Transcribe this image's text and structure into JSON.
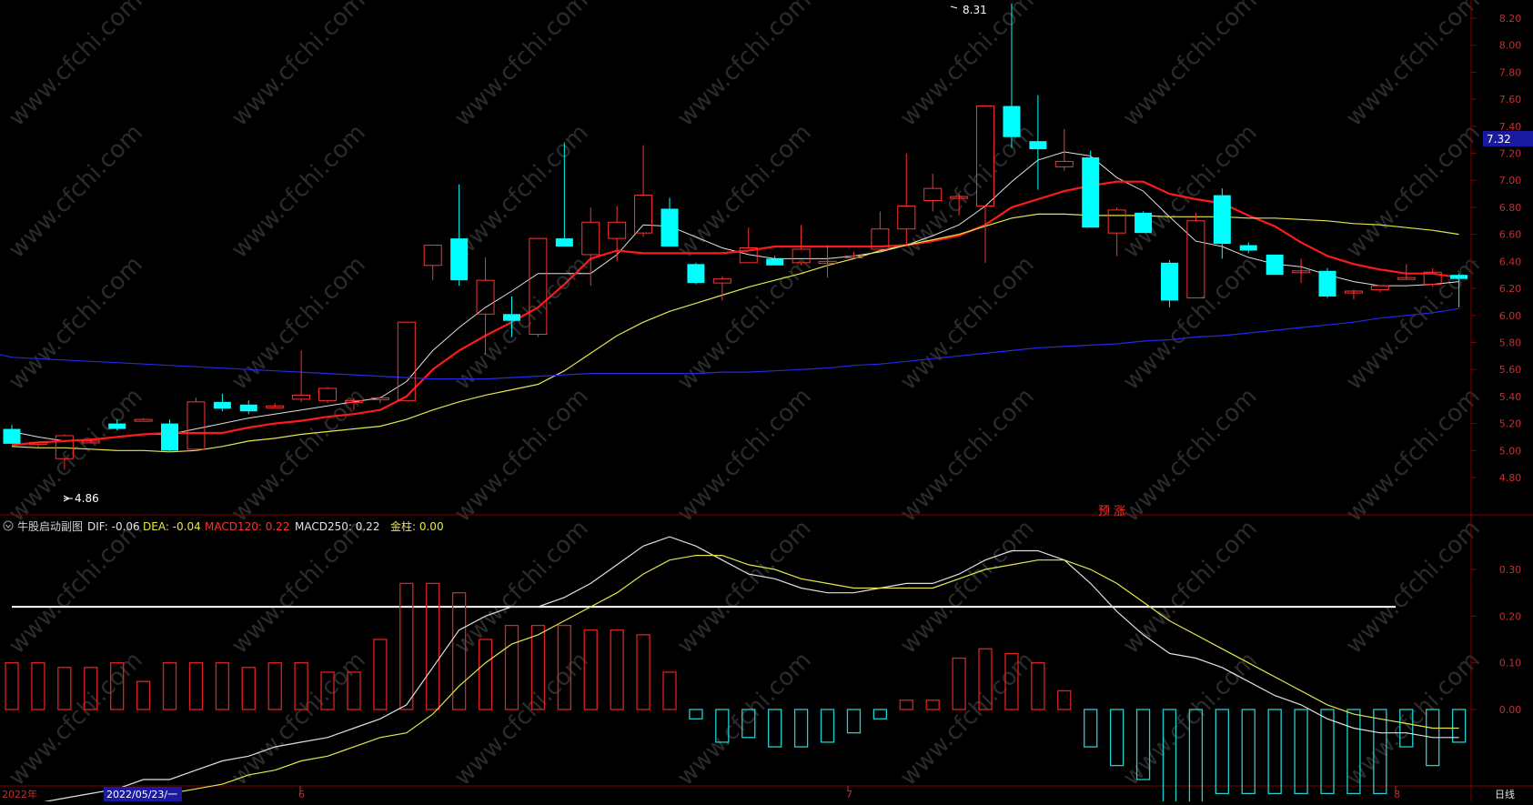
{
  "colors": {
    "background": "#000000",
    "frame": "#800000",
    "axis_text": "#c03030",
    "up_candle": "#ff3232",
    "down_candle": "#00ffff",
    "ma5": "#e0e0e0",
    "ma10": "#ff1a1a",
    "ma20": "#e6e64c",
    "ma60": "#2828e6",
    "dif": "#e0e0e0",
    "dea": "#e6e64c",
    "hist_pos": "#e02020",
    "hist_neg": "#20d0d0",
    "ref_line": "#ffffff",
    "watermark": "#2b2b2b"
  },
  "main_panel": {
    "price_axis_ticks": [
      "8.20",
      "8.00",
      "7.80",
      "7.60",
      "7.40",
      "7.20",
      "7.00",
      "6.80",
      "6.60",
      "6.40",
      "6.20",
      "6.00",
      "5.80",
      "5.60",
      "5.40",
      "5.20",
      "5.00",
      "4.80"
    ],
    "current_price_tag": "7.32",
    "high_annotation": "8.31",
    "low_annotation": "4.86",
    "signal_text": "预  涨",
    "watermark_text": "www.cfchi.com"
  },
  "indicator_panel": {
    "name": "牛股启动副图",
    "dif_label": "DIF: -0.06",
    "dea_label": "DEA: -0.04",
    "macd120_label": "MACD120: 0.22",
    "macd250_label": "MACD250: 0.22",
    "jinzhu_label": "金柱: 0.00",
    "axis_ticks": [
      "0.30",
      "0.20",
      "0.10",
      "0.00"
    ],
    "collapse_icon": "chevron-down-circle-icon"
  },
  "bottom_bar": {
    "year_label": "2022年",
    "cursor_date": "2022/05/23/一",
    "month_6": "6",
    "month_7": "7",
    "month_8": "8",
    "period_label": "日线"
  },
  "chart_data": [
    {
      "type": "candlestick",
      "title": "",
      "ylim": [
        4.72,
        8.31
      ],
      "fields": [
        "open",
        "high",
        "low",
        "close"
      ],
      "candles": [
        [
          5.16,
          5.19,
          5.05,
          5.05
        ],
        [
          5.05,
          5.06,
          5.02,
          5.06
        ],
        [
          4.94,
          5.12,
          4.86,
          5.11
        ],
        [
          5.07,
          5.09,
          5.06,
          5.07
        ],
        [
          5.2,
          5.23,
          5.15,
          5.16
        ],
        [
          5.22,
          5.24,
          5.22,
          5.23
        ],
        [
          5.2,
          5.23,
          4.99,
          5.0
        ],
        [
          5.01,
          5.39,
          5.0,
          5.36
        ],
        [
          5.36,
          5.42,
          5.29,
          5.31
        ],
        [
          5.34,
          5.37,
          5.27,
          5.29
        ],
        [
          5.33,
          5.35,
          5.32,
          5.33
        ],
        [
          5.38,
          5.74,
          5.36,
          5.41
        ],
        [
          5.37,
          5.47,
          5.35,
          5.46
        ],
        [
          5.37,
          5.39,
          5.3,
          5.37
        ],
        [
          5.38,
          5.4,
          5.35,
          5.39
        ],
        [
          5.37,
          5.95,
          5.37,
          5.95
        ],
        [
          6.37,
          6.52,
          6.26,
          6.52
        ],
        [
          6.57,
          6.97,
          6.22,
          6.26
        ],
        [
          6.01,
          6.43,
          5.71,
          6.26
        ],
        [
          6.01,
          6.14,
          5.84,
          5.96
        ],
        [
          5.86,
          6.57,
          5.84,
          6.57
        ],
        [
          6.57,
          7.28,
          6.54,
          6.51
        ],
        [
          6.45,
          6.8,
          6.22,
          6.69
        ],
        [
          6.57,
          6.81,
          6.4,
          6.69
        ],
        [
          6.61,
          7.26,
          6.58,
          6.89
        ],
        [
          6.79,
          6.87,
          6.51,
          6.51
        ],
        [
          6.38,
          6.39,
          6.23,
          6.24
        ],
        [
          6.24,
          6.29,
          6.11,
          6.27
        ],
        [
          6.39,
          6.65,
          6.39,
          6.5
        ],
        [
          6.42,
          6.44,
          6.37,
          6.37
        ],
        [
          6.39,
          6.67,
          6.37,
          6.49
        ],
        [
          6.4,
          6.52,
          6.28,
          6.4
        ],
        [
          6.44,
          6.47,
          6.42,
          6.44
        ],
        [
          6.49,
          6.77,
          6.48,
          6.64
        ],
        [
          6.64,
          7.2,
          6.52,
          6.81
        ],
        [
          6.85,
          7.05,
          6.77,
          6.94
        ],
        [
          6.88,
          6.9,
          6.74,
          6.88
        ],
        [
          6.81,
          7.55,
          6.39,
          7.55
        ],
        [
          7.55,
          8.31,
          7.24,
          7.32
        ],
        [
          7.29,
          7.63,
          6.93,
          7.23
        ],
        [
          7.1,
          7.38,
          7.07,
          7.14
        ],
        [
          7.17,
          7.22,
          6.65,
          6.65
        ],
        [
          6.61,
          6.8,
          6.44,
          6.78
        ],
        [
          6.76,
          6.77,
          6.61,
          6.61
        ],
        [
          6.39,
          6.41,
          6.06,
          6.11
        ],
        [
          6.13,
          6.76,
          6.13,
          6.7
        ],
        [
          6.89,
          6.94,
          6.42,
          6.53
        ],
        [
          6.52,
          6.54,
          6.46,
          6.48
        ],
        [
          6.45,
          6.45,
          6.3,
          6.3
        ],
        [
          6.33,
          6.42,
          6.24,
          6.33
        ],
        [
          6.33,
          6.35,
          6.13,
          6.14
        ],
        [
          6.18,
          6.19,
          6.12,
          6.18
        ],
        [
          6.19,
          6.22,
          6.17,
          6.22
        ],
        [
          6.28,
          6.38,
          6.27,
          6.28
        ],
        [
          6.23,
          6.35,
          6.21,
          6.32
        ],
        [
          6.3,
          6.31,
          6.06,
          6.27
        ]
      ],
      "series": [
        {
          "values": [
            5.14,
            5.1,
            5.07,
            5.08,
            5.1,
            5.12,
            5.12,
            5.16,
            5.2,
            5.24,
            5.27,
            5.3,
            5.33,
            5.36,
            5.39,
            5.51,
            5.74,
            5.91,
            6.06,
            6.18,
            6.31,
            6.31,
            6.31,
            6.45,
            6.67,
            6.66,
            6.58,
            6.5,
            6.45,
            6.42,
            6.42,
            6.42,
            6.44,
            6.47,
            6.52,
            6.59,
            6.67,
            6.81,
            6.99,
            7.15,
            7.21,
            7.18,
            7.02,
            6.92,
            6.73,
            6.55,
            6.51,
            6.43,
            6.38,
            6.36,
            6.3,
            6.25,
            6.22,
            6.22,
            6.23,
            6.25
          ]
        },
        {
          "values": [
            5.04,
            5.06,
            5.07,
            5.08,
            5.1,
            5.12,
            5.13,
            5.13,
            5.13,
            5.17,
            5.2,
            5.22,
            5.25,
            5.27,
            5.3,
            5.4,
            5.6,
            5.74,
            5.85,
            5.95,
            6.06,
            6.23,
            6.42,
            6.48,
            6.46,
            6.46,
            6.46,
            6.46,
            6.48,
            6.51,
            6.51,
            6.51,
            6.51,
            6.51,
            6.52,
            6.55,
            6.59,
            6.67,
            6.8,
            6.86,
            6.92,
            6.96,
            6.99,
            6.99,
            6.9,
            6.86,
            6.83,
            6.74,
            6.66,
            6.54,
            6.44,
            6.38,
            6.34,
            6.31,
            6.31,
            6.28
          ]
        },
        {
          "values": [
            5.03,
            5.02,
            5.02,
            5.01,
            5.0,
            5.0,
            4.99,
            5.0,
            5.03,
            5.07,
            5.09,
            5.12,
            5.14,
            5.16,
            5.18,
            5.23,
            5.3,
            5.36,
            5.41,
            5.45,
            5.49,
            5.59,
            5.72,
            5.85,
            5.95,
            6.03,
            6.09,
            6.15,
            6.21,
            6.26,
            6.31,
            6.37,
            6.42,
            6.48,
            6.52,
            6.56,
            6.6,
            6.66,
            6.72,
            6.75,
            6.75,
            6.74,
            6.74,
            6.74,
            6.73,
            6.73,
            6.73,
            6.72,
            6.72,
            6.71,
            6.7,
            6.68,
            6.67,
            6.65,
            6.63,
            6.6
          ]
        },
        {
          "values": [
            5.69,
            5.68,
            5.67,
            5.66,
            5.65,
            5.64,
            5.63,
            5.62,
            5.61,
            5.6,
            5.59,
            5.58,
            5.57,
            5.56,
            5.55,
            5.54,
            5.53,
            5.53,
            5.53,
            5.54,
            5.55,
            5.56,
            5.57,
            5.57,
            5.57,
            5.57,
            5.57,
            5.58,
            5.58,
            5.59,
            5.6,
            5.61,
            5.63,
            5.64,
            5.66,
            5.68,
            5.7,
            5.72,
            5.74,
            5.76,
            5.77,
            5.78,
            5.79,
            5.81,
            5.82,
            5.84,
            5.85,
            5.87,
            5.89,
            5.91,
            5.93,
            5.95,
            5.98,
            6.0,
            6.02,
            6.05
          ]
        }
      ]
    },
    {
      "type": "bar",
      "title": "",
      "ylim": [
        -0.27,
        0.41
      ],
      "ticks": [
        0.3,
        0.2,
        0.1,
        0.0
      ],
      "reference_level": 0.22,
      "histogram": [
        0.1,
        0.1,
        0.09,
        0.09,
        0.1,
        0.06,
        0.1,
        0.1,
        0.1,
        0.09,
        0.1,
        0.1,
        0.08,
        0.08,
        0.15,
        0.27,
        0.27,
        0.25,
        0.15,
        0.18,
        0.18,
        0.18,
        0.17,
        0.17,
        0.16,
        0.08,
        -0.02,
        -0.07,
        -0.06,
        -0.08,
        -0.08,
        -0.07,
        -0.05,
        -0.02,
        0.02,
        0.02,
        0.11,
        0.13,
        0.12,
        0.1,
        0.04,
        -0.08,
        -0.12,
        -0.15,
        -0.27,
        -0.2,
        -0.18,
        -0.18,
        -0.18,
        -0.18,
        -0.18,
        -0.18,
        -0.18,
        -0.08,
        -0.12,
        -0.07
      ],
      "series": [
        {
          "values": [
            -0.21,
            -0.2,
            -0.19,
            -0.18,
            -0.17,
            -0.15,
            -0.15,
            -0.13,
            -0.11,
            -0.1,
            -0.08,
            -0.07,
            -0.06,
            -0.04,
            -0.02,
            0.01,
            0.09,
            0.17,
            0.2,
            0.22,
            0.22,
            0.24,
            0.27,
            0.31,
            0.35,
            0.37,
            0.35,
            0.32,
            0.29,
            0.28,
            0.26,
            0.25,
            0.25,
            0.26,
            0.27,
            0.27,
            0.29,
            0.32,
            0.34,
            0.34,
            0.32,
            0.27,
            0.21,
            0.16,
            0.12,
            0.11,
            0.09,
            0.06,
            0.03,
            0.01,
            -0.02,
            -0.04,
            -0.05,
            -0.05,
            -0.06,
            -0.06
          ]
        },
        {
          "values": [
            -0.24,
            -0.23,
            -0.22,
            -0.21,
            -0.2,
            -0.19,
            -0.18,
            -0.17,
            -0.16,
            -0.14,
            -0.13,
            -0.11,
            -0.1,
            -0.08,
            -0.06,
            -0.05,
            -0.01,
            0.05,
            0.1,
            0.14,
            0.16,
            0.19,
            0.22,
            0.25,
            0.29,
            0.32,
            0.33,
            0.33,
            0.31,
            0.3,
            0.28,
            0.27,
            0.26,
            0.26,
            0.26,
            0.26,
            0.28,
            0.3,
            0.31,
            0.32,
            0.32,
            0.3,
            0.27,
            0.23,
            0.19,
            0.16,
            0.13,
            0.1,
            0.07,
            0.04,
            0.01,
            -0.01,
            -0.02,
            -0.03,
            -0.04,
            -0.04
          ]
        }
      ]
    }
  ]
}
